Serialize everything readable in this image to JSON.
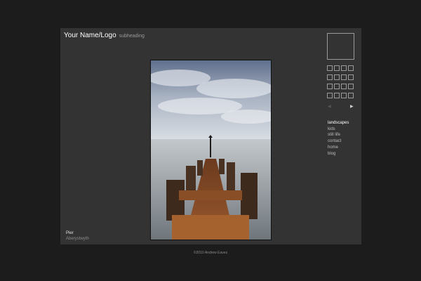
{
  "header": {
    "logo": "Your Name/Logo",
    "subheading": "subheading"
  },
  "caption": {
    "title": "Pier",
    "location": "Aberystwyth"
  },
  "gallery": {
    "thumbnail_rows": 4,
    "thumbnail_cols": 4,
    "prev_icon": "triangle-left-icon",
    "next_icon": "triangle-right-icon",
    "prev_glyph": "◀",
    "next_glyph": "▶"
  },
  "nav": {
    "items": [
      {
        "label": "landscapes"
      },
      {
        "label": "kids"
      },
      {
        "label": "still life"
      },
      {
        "label": "contact"
      },
      {
        "label": "home"
      },
      {
        "label": "blog"
      }
    ],
    "active_index": 0
  },
  "footer": {
    "copyright": "©2010 Andrew Eaves"
  },
  "colors": {
    "page_bg": "#1c1c1c",
    "panel_bg": "#333333",
    "text_primary": "#ffffff",
    "text_muted": "#9a9a9a"
  }
}
